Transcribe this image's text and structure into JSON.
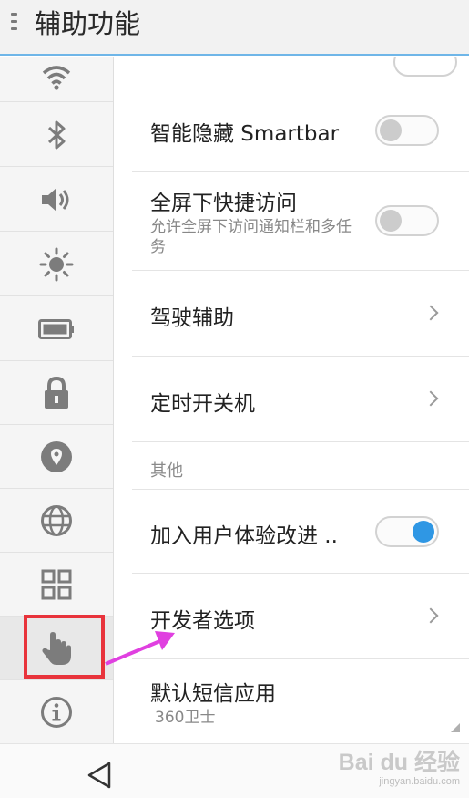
{
  "header": {
    "title": "辅助功能"
  },
  "sidebar": {
    "items": [
      {
        "icon": "wifi-icon"
      },
      {
        "icon": "bluetooth-icon"
      },
      {
        "icon": "volume-icon"
      },
      {
        "icon": "brightness-icon"
      },
      {
        "icon": "battery-icon"
      },
      {
        "icon": "lock-icon"
      },
      {
        "icon": "location-icon"
      },
      {
        "icon": "globe-icon"
      },
      {
        "icon": "apps-grid-icon"
      },
      {
        "icon": "hand-pointer-icon",
        "active": true
      },
      {
        "icon": "info-icon"
      }
    ],
    "highlight_color": "#e8333b"
  },
  "settings": {
    "smartbar": {
      "title": "智能隐藏 Smartbar",
      "enabled": false
    },
    "quick_access": {
      "title": "全屏下快捷访问",
      "subtitle": "允许全屏下访问通知栏和多任务",
      "enabled": false
    },
    "driving": {
      "title": "驾驶辅助"
    },
    "timer_power": {
      "title": "定时开关机"
    },
    "section_other": "其他",
    "ux_program": {
      "title": "加入用户体验改进 ..",
      "enabled": true
    },
    "developer": {
      "title": "开发者选项"
    },
    "sms_app": {
      "title": "默认短信应用",
      "subtitle": "360卫士"
    }
  },
  "watermark": {
    "brand": "Bai du 经验",
    "url": "jingyan.baidu.com"
  },
  "colors": {
    "accent": "#2f97e4",
    "arrow": "#e040e0",
    "header_line": "#6fb6e8"
  }
}
